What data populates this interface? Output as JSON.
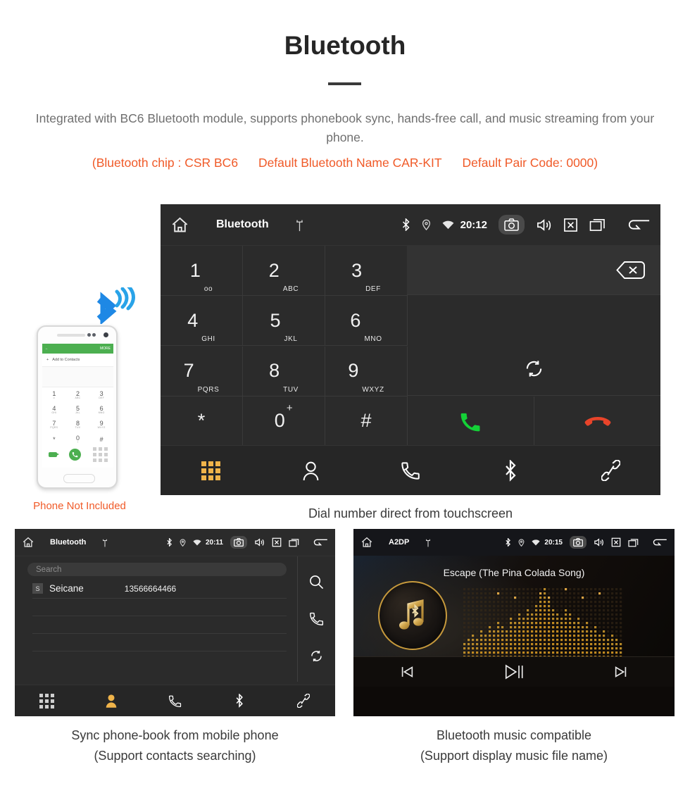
{
  "header": {
    "title": "Bluetooth",
    "description": "Integrated with BC6 Bluetooth module, supports phonebook sync, hands-free call, and music streaming from your phone.",
    "spec_chip": "(Bluetooth chip : CSR BC6",
    "spec_name": "Default Bluetooth Name CAR-KIT",
    "spec_pair": "Default Pair Code: 0000)",
    "accent_color": "#f05a28",
    "text_color": "#6f6f6f"
  },
  "dialer_screen": {
    "status_bar": {
      "title": "Bluetooth",
      "clock": "20:12",
      "icons": [
        "home-icon",
        "usb-icon",
        "bluetooth-icon",
        "location-icon",
        "wifi-icon",
        "camera-icon",
        "volume-icon",
        "close-icon",
        "recents-icon",
        "back-icon"
      ]
    },
    "keys": [
      {
        "num": "1",
        "sub": "oo"
      },
      {
        "num": "2",
        "sub": "ABC"
      },
      {
        "num": "3",
        "sub": "DEF"
      },
      {
        "num": "4",
        "sub": "GHI"
      },
      {
        "num": "5",
        "sub": "JKL"
      },
      {
        "num": "6",
        "sub": "MNO"
      },
      {
        "num": "7",
        "sub": "PQRS"
      },
      {
        "num": "8",
        "sub": "TUV"
      },
      {
        "num": "9",
        "sub": "WXYZ"
      },
      {
        "num": "*",
        "sub": ""
      },
      {
        "num": "0",
        "sub": "+"
      },
      {
        "num": "#",
        "sub": ""
      }
    ],
    "number_value": "",
    "actions": [
      "backspace-icon",
      "sync-icon",
      "call-answer-button",
      "call-hangup-button"
    ],
    "tabs": [
      {
        "name": "dialpad",
        "active": true
      },
      {
        "name": "contacts",
        "active": false
      },
      {
        "name": "call-log",
        "active": false
      },
      {
        "name": "bluetooth",
        "active": false
      },
      {
        "name": "link",
        "active": false
      }
    ],
    "active_tab_color": "#f0b44a",
    "caption": "Dial number direct from touchscreen"
  },
  "phone_mockup": {
    "app_bar_more": "MORE",
    "add_to_contacts": "Add to Contacts",
    "keys": [
      {
        "num": "1",
        "sub": "∞"
      },
      {
        "num": "2",
        "sub": "ABC"
      },
      {
        "num": "3",
        "sub": "DEF"
      },
      {
        "num": "4",
        "sub": "GHI"
      },
      {
        "num": "5",
        "sub": "JKL"
      },
      {
        "num": "6",
        "sub": "MNO"
      },
      {
        "num": "7",
        "sub": "PQRS"
      },
      {
        "num": "8",
        "sub": "TUV"
      },
      {
        "num": "9",
        "sub": "WXYZ"
      },
      {
        "num": "*",
        "sub": ""
      },
      {
        "num": "0",
        "sub": "+"
      },
      {
        "num": "#",
        "sub": ""
      }
    ],
    "note": "Phone Not Included",
    "note_color": "#f05a28",
    "accent_color": "#4caf50"
  },
  "phonebook_screen": {
    "status_bar": {
      "title": "Bluetooth",
      "clock": "20:11"
    },
    "search_placeholder": "Search",
    "contacts": [
      {
        "initial": "S",
        "name": "Seicane",
        "number": "13566664466"
      }
    ],
    "side_actions": [
      "search-icon",
      "call-icon",
      "sync-icon"
    ],
    "tabs": [
      {
        "name": "dialpad",
        "active": false
      },
      {
        "name": "contacts",
        "active": true
      },
      {
        "name": "call-log",
        "active": false
      },
      {
        "name": "bluetooth",
        "active": false
      },
      {
        "name": "link",
        "active": false
      }
    ],
    "caption_line1": "Sync phone-book from mobile phone",
    "caption_line2": "(Support contacts searching)"
  },
  "music_screen": {
    "status_bar": {
      "title": "A2DP",
      "clock": "20:15"
    },
    "song_title": "Escape (The Pina Colada Song)",
    "controls": [
      "previous-button",
      "play-pause-button",
      "next-button"
    ],
    "accent_color": "#c79a3c",
    "caption_line1": "Bluetooth music compatible",
    "caption_line2": "(Support display music file name)"
  }
}
